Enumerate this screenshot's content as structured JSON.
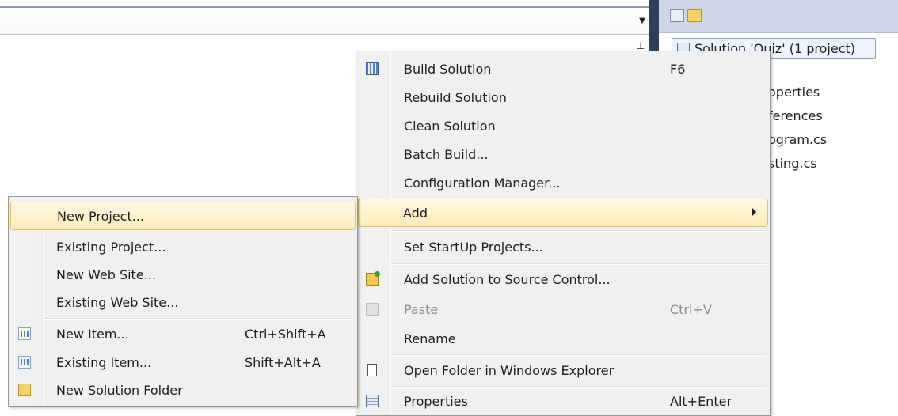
{
  "solution_explorer": {
    "root_label": "Solution 'Quiz' (1 project)",
    "tree_items": [
      "operties",
      "ferences",
      "ogram.cs",
      "sting.cs"
    ]
  },
  "context_menu": {
    "items": [
      {
        "label": "Build Solution",
        "shortcut": "F6",
        "icon": "build-solution-icon"
      },
      {
        "label": "Rebuild Solution",
        "shortcut": ""
      },
      {
        "label": "Clean Solution",
        "shortcut": ""
      },
      {
        "label": "Batch Build...",
        "shortcut": ""
      },
      {
        "label": "Configuration Manager...",
        "shortcut": ""
      },
      {
        "label": "Add",
        "shortcut": "",
        "submenu": true,
        "highlighted": true
      },
      {
        "label": "Set StartUp Projects...",
        "shortcut": ""
      },
      {
        "label": "Add Solution to Source Control...",
        "shortcut": "",
        "icon": "source-control-icon"
      },
      {
        "label": "Paste",
        "shortcut": "Ctrl+V",
        "disabled": true,
        "icon": "paste-icon"
      },
      {
        "label": "Rename",
        "shortcut": ""
      },
      {
        "label": "Open Folder in Windows Explorer",
        "shortcut": "",
        "icon": "open-folder-icon"
      },
      {
        "label": "Properties",
        "shortcut": "Alt+Enter",
        "icon": "properties-icon"
      }
    ]
  },
  "add_submenu": {
    "items": [
      {
        "label": "New Project...",
        "shortcut": "",
        "highlighted": true
      },
      {
        "label": "Existing Project...",
        "shortcut": ""
      },
      {
        "label": "New Web Site...",
        "shortcut": ""
      },
      {
        "label": "Existing Web Site...",
        "shortcut": ""
      },
      {
        "label": "New Item...",
        "shortcut": "Ctrl+Shift+A",
        "icon": "new-item-icon"
      },
      {
        "label": "Existing Item...",
        "shortcut": "Shift+Alt+A",
        "icon": "existing-item-icon"
      },
      {
        "label": "New Solution Folder",
        "shortcut": "",
        "icon": "solution-folder-icon"
      }
    ]
  },
  "colors": {
    "highlight_top": "#fff8e3",
    "highlight_bottom": "#fdebb8",
    "highlight_border": "#e5c365",
    "menu_background": "#f0f0f0",
    "splitter": "#2f3e5a"
  }
}
